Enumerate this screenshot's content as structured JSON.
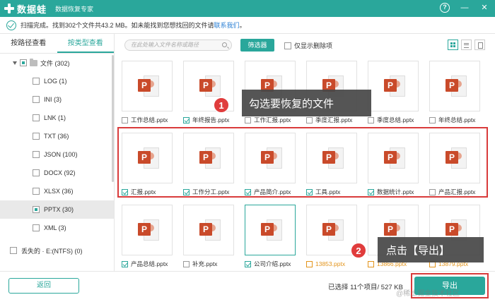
{
  "titlebar": {
    "app_name": "数据蛙",
    "subtitle": "数据恢复专家",
    "help_icon": "?",
    "minimize_icon": "—",
    "close_icon": "✕"
  },
  "infobar": {
    "message": "扫描完成。找到302个文件共43.2 MB。如未能找到您想找回的文件请",
    "link": "联系我们",
    "link_suffix": "。"
  },
  "sidebar": {
    "tabs": [
      "按路径查看",
      "按类型查看"
    ],
    "active_tab": 1,
    "root": "文件 (302)",
    "items": [
      {
        "label": "LOG (1)"
      },
      {
        "label": "INI (3)"
      },
      {
        "label": "LNK (1)"
      },
      {
        "label": "TXT (36)"
      },
      {
        "label": "JSON (100)"
      },
      {
        "label": "DOCX (92)"
      },
      {
        "label": "XLSX (36)"
      },
      {
        "label": "PPTX (30)",
        "selected": true
      },
      {
        "label": "XML (3)"
      }
    ],
    "lost": "丢失的 · E:(NTFS) (0)"
  },
  "toolbar": {
    "search_placeholder": "在此处输入文件名称或路径",
    "filter_label": "筛选器",
    "only_deleted_label": "仅显示删除项"
  },
  "files": [
    {
      "name": "工作总结.pptx",
      "checked": false,
      "deleted": false
    },
    {
      "name": "年终报告.pptx",
      "checked": true,
      "deleted": false
    },
    {
      "name": "工作汇报.pptx",
      "checked": false,
      "deleted": false
    },
    {
      "name": "季度汇报.pptx",
      "checked": false,
      "deleted": false
    },
    {
      "name": "季度总结.pptx",
      "checked": false,
      "deleted": false
    },
    {
      "name": "年终总结.pptx",
      "checked": false,
      "deleted": false
    },
    {
      "name": "汇报.pptx",
      "checked": true,
      "deleted": false
    },
    {
      "name": "工作分工.pptx",
      "checked": true,
      "deleted": false
    },
    {
      "name": "产品简介.pptx",
      "checked": true,
      "deleted": false
    },
    {
      "name": "工具.pptx",
      "checked": true,
      "deleted": false
    },
    {
      "name": "数据统计.pptx",
      "checked": true,
      "deleted": false
    },
    {
      "name": "产品汇报.pptx",
      "checked": false,
      "deleted": false
    },
    {
      "name": "产品总结.pptx",
      "checked": true,
      "deleted": false
    },
    {
      "name": "补充.pptx",
      "checked": false,
      "deleted": false
    },
    {
      "name": "公司介绍.pptx",
      "checked": true,
      "deleted": false
    },
    {
      "name": "13853.pptx",
      "checked": false,
      "deleted": true
    },
    {
      "name": "13866.pptx",
      "checked": false,
      "deleted": true
    },
    {
      "name": "13879.pptx",
      "checked": false,
      "deleted": true
    }
  ],
  "callouts": {
    "one_num": "1",
    "one_text": "勾选要恢复的文件",
    "two_num": "2",
    "two_text": "点击【导出】"
  },
  "footer": {
    "back_label": "返回",
    "selected_info": "已选择 11个项目/ 527 KB",
    "export_label": "导出",
    "watermark": "@稀土掘金技术社区"
  },
  "colors": {
    "accent": "#2aa79b",
    "highlight_red": "#d93b3b",
    "deleted_orange": "#e3941b",
    "ppt_red": "#c94a2a"
  }
}
